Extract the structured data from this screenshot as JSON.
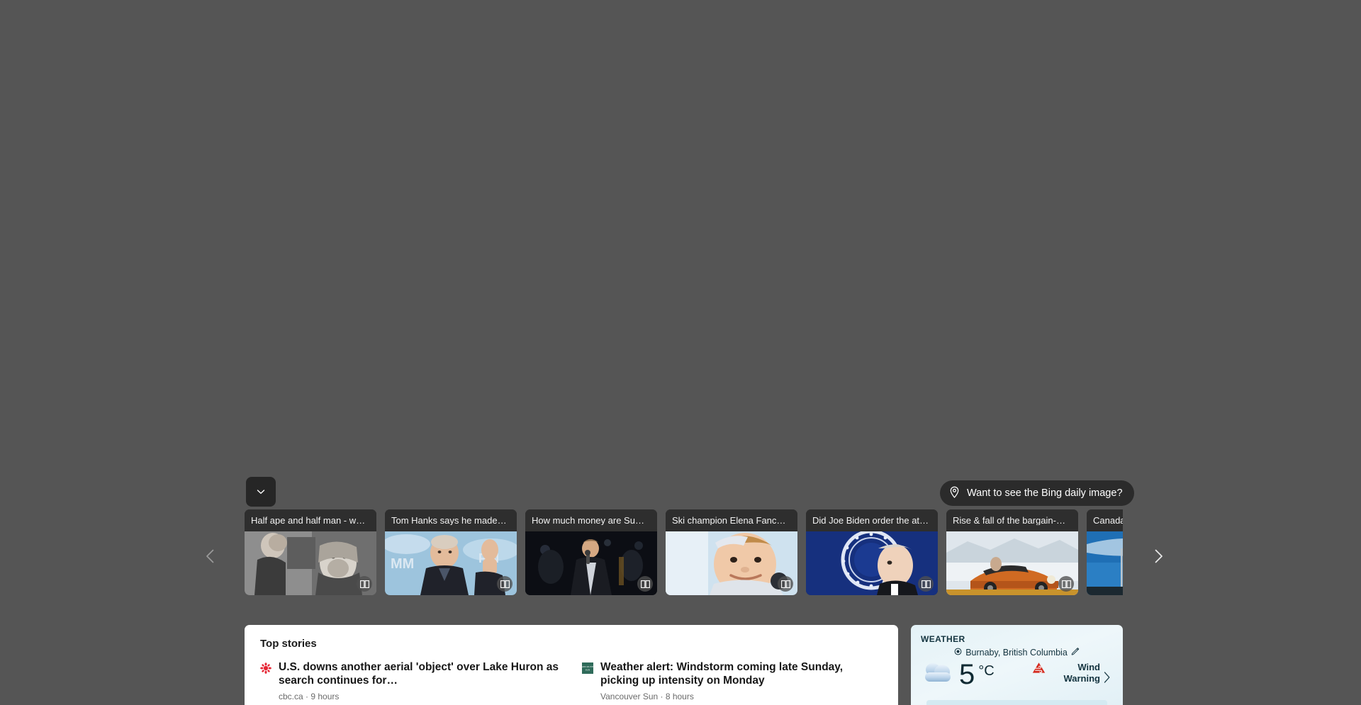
{
  "colors": {
    "page_background": "#555555",
    "card_background": "#2e2e2e",
    "panel_white": "#ffffff",
    "weather_bg": "#e8f4f8",
    "weather_text": "#13333f",
    "alert_red": "#d42a1e",
    "cbc_red": "#e52534",
    "vancouver_sun_green": "#2f6b5a"
  },
  "scroll_down": {
    "icon": "chevron-down-icon",
    "label": "Scroll down"
  },
  "bing_prompt": {
    "icon": "location-pin-icon",
    "label": "Want to see the Bing daily image?"
  },
  "carousel": {
    "prev_icon": "chevron-left-icon",
    "next_icon": "chevron-right-icon",
    "badge_icon": "read-article-icon",
    "cards": [
      {
        "title": "Half ape and half man - w…",
        "image": "bw-woman-and-ape-sculpture"
      },
      {
        "title": "Tom Hanks says he made…",
        "image": "tom-hanks-waving"
      },
      {
        "title": "How much money are Su…",
        "image": "singer-on-stage"
      },
      {
        "title": "Ski champion Elena Fanc…",
        "image": "smiling-ski-champion"
      },
      {
        "title": "Did Joe Biden order the at…",
        "image": "joe-biden-presidential-seal"
      },
      {
        "title": "Rise & fall of the bargain-…",
        "image": "orange-convertible-car"
      },
      {
        "title": "Canada is",
        "image": "canadian-flag-parliament"
      }
    ]
  },
  "top_stories": {
    "heading": "Top stories",
    "items": [
      {
        "logo": "cbc-logo",
        "headline": "U.S. downs another aerial 'object' over Lake Huron as search continues for…",
        "source": "cbc.ca · 9 hours"
      },
      {
        "logo": "vancouver-sun-logo",
        "headline": "Weather alert: Windstorm coming late Sunday, picking up intensity on Monday",
        "source": "Vancouver Sun · 8 hours"
      }
    ]
  },
  "weather": {
    "title": "WEATHER",
    "location": "Burnaby, British Columbia",
    "location_icon": "location-target-icon",
    "edit_icon": "pencil-edit-icon",
    "condition_icon": "cloudy-icon",
    "temperature": "5",
    "unit": "°C",
    "alert_icon": "wind-warning-icon",
    "alert_text": "Wind Warning",
    "chevron_icon": "chevron-right-icon"
  }
}
